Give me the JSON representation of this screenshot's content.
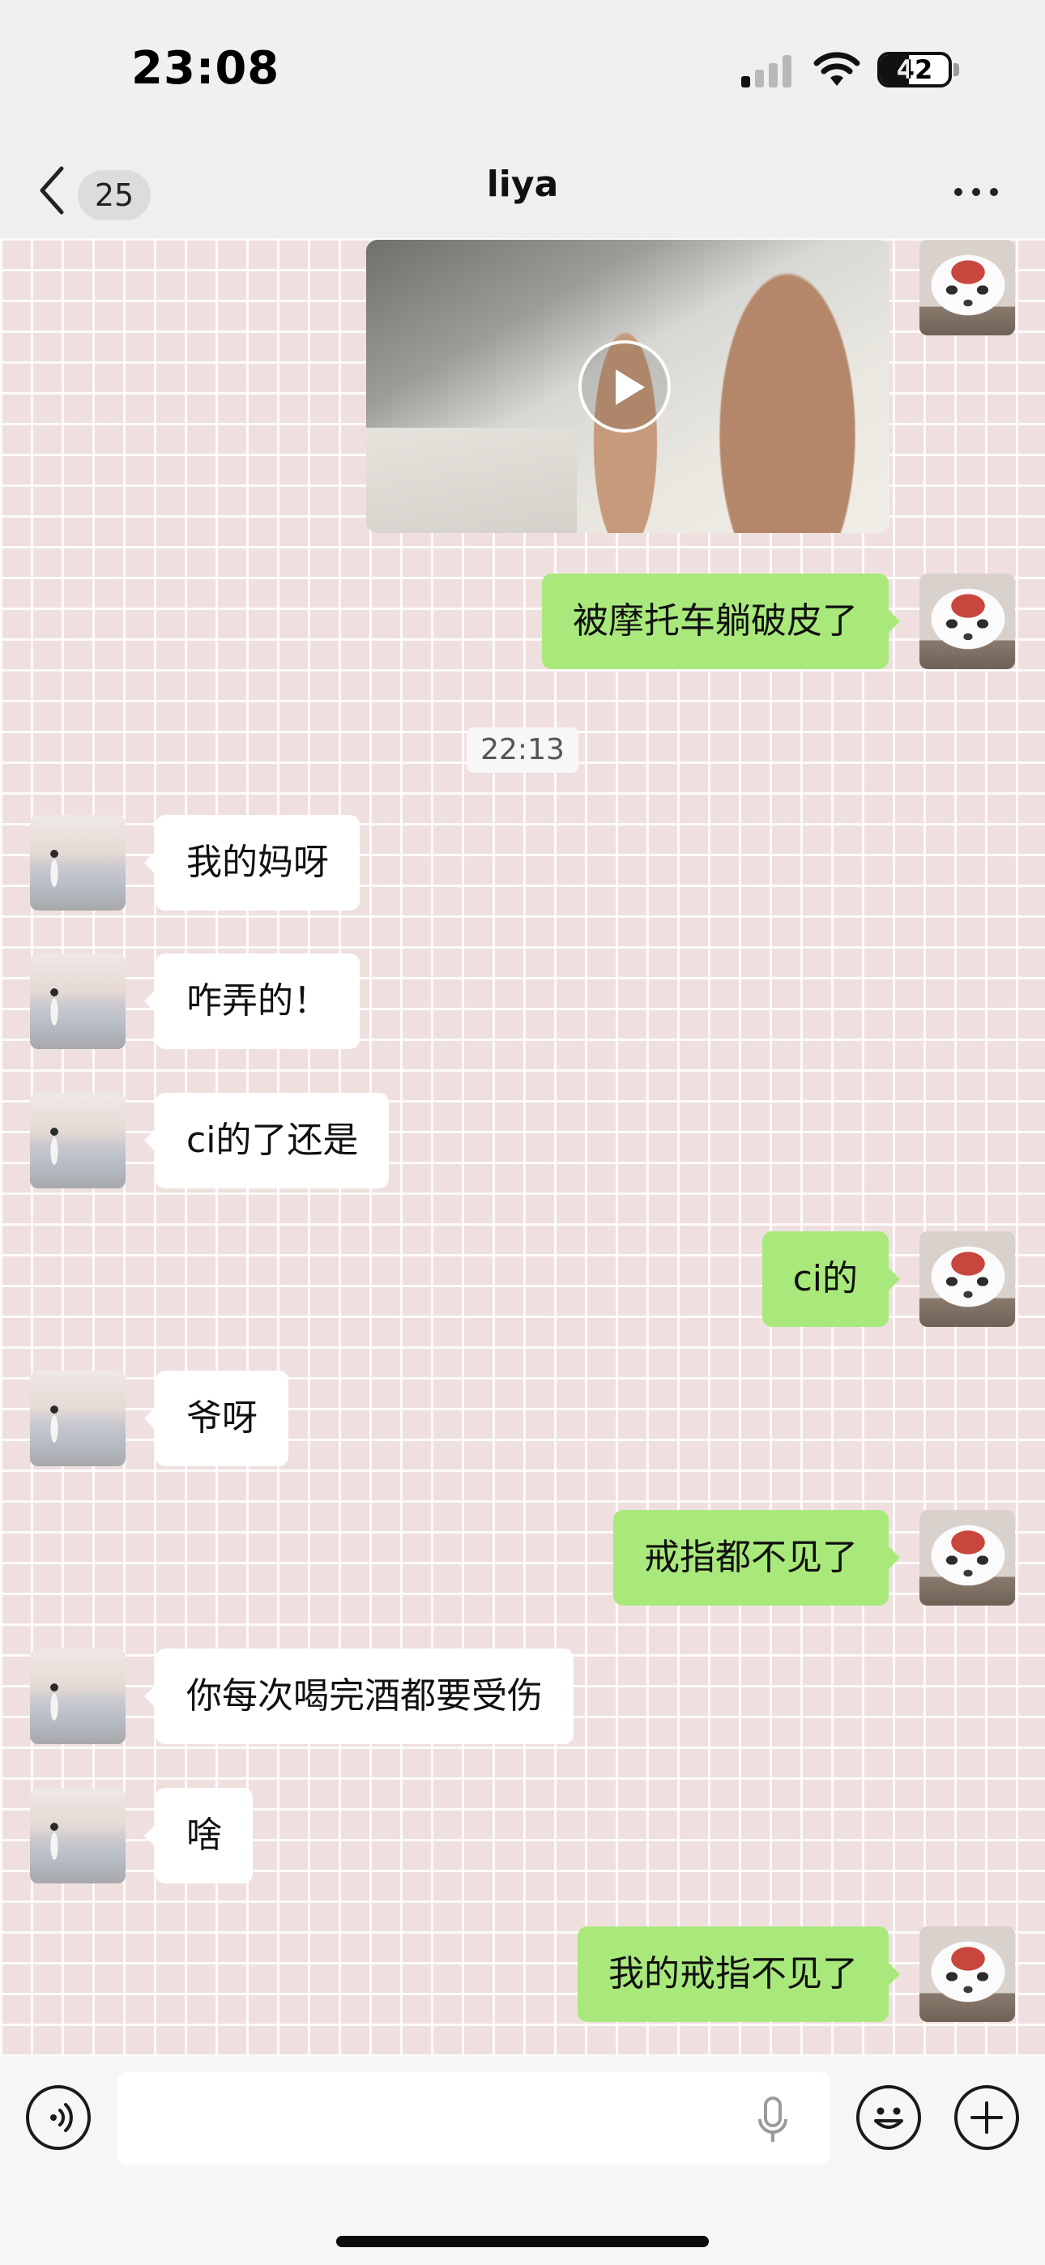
{
  "status_bar": {
    "time": "23:08",
    "battery_percent": "42",
    "battery_level": 0.42,
    "signal_bars_active": 1,
    "signal_bars_total": 4
  },
  "nav": {
    "unread_count": "25",
    "title": "liya",
    "back_icon": "chevron-left-icon",
    "more_icon": "ellipsis-icon"
  },
  "colors": {
    "outgoing_bubble": "#a9e97c",
    "incoming_bubble": "#ffffff",
    "chat_background": "#efe0df"
  },
  "messages": [
    {
      "side": "right",
      "type": "video",
      "text": ""
    },
    {
      "side": "right",
      "type": "text",
      "text": "被摩托车躺破皮了"
    },
    {
      "side": "center",
      "type": "timestamp",
      "text": "22:13"
    },
    {
      "side": "left",
      "type": "text",
      "text": "我的妈呀"
    },
    {
      "side": "left",
      "type": "text",
      "text": "咋弄的！"
    },
    {
      "side": "left",
      "type": "text",
      "text": "ci的了还是"
    },
    {
      "side": "right",
      "type": "text",
      "text": "ci的"
    },
    {
      "side": "left",
      "type": "text",
      "text": "爷呀"
    },
    {
      "side": "right",
      "type": "text",
      "text": "戒指都不见了"
    },
    {
      "side": "left",
      "type": "text",
      "text": "你每次喝完酒都要受伤"
    },
    {
      "side": "left",
      "type": "text",
      "text": "啥"
    },
    {
      "side": "right",
      "type": "text",
      "text": "我的戒指不见了"
    }
  ],
  "input_bar": {
    "value": "",
    "placeholder": "",
    "voice_icon": "voice-icon",
    "mic_icon": "microphone-icon",
    "emoji_icon": "emoji-icon",
    "plus_icon": "plus-icon"
  }
}
